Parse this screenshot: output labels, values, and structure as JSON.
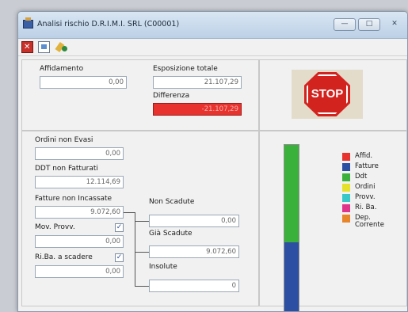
{
  "window": {
    "title": "Analisi rischio D.R.I.M.I. SRL (C00001)",
    "buttons": {
      "minimize": "—",
      "maximize": "□",
      "close": "✕"
    }
  },
  "toolbar": {
    "icons": [
      "close-red-icon",
      "document-icon",
      "tools-icon"
    ]
  },
  "top_left": {
    "affidamento_label": "Affidamento",
    "affidamento_value": "0,00",
    "esposizione_label": "Esposizione totale",
    "esposizione_value": "21.107,29",
    "differenza_label": "Differenza",
    "differenza_value": "-21.107,29"
  },
  "stop": {
    "text": "STOP"
  },
  "bottom_left": {
    "ordini_label": "Ordini non Evasi",
    "ordini_value": "0,00",
    "ddt_label": "DDT non Fatturati",
    "ddt_value": "12.114,69",
    "fatture_label": "Fatture non Incassate",
    "fatture_value": "9.072,60",
    "mov_label": "Mov. Provv.",
    "mov_checked": "✓",
    "mov_value": "0,00",
    "riba_label": "Ri.Ba. a scadere",
    "riba_checked": "✓",
    "riba_value": "0,00",
    "non_scadute_label": "Non Scadute",
    "non_scadute_value": "0,00",
    "gia_scadute_label": "Già Scadute",
    "gia_scadute_value": "9.072,60",
    "insolute_label": "Insolute",
    "insolute_value": "0"
  },
  "chart_data": {
    "type": "bar",
    "categories": [
      ""
    ],
    "series": [
      {
        "name": "Affid.",
        "color": "#e8322e",
        "values": [
          0
        ]
      },
      {
        "name": "Fatture",
        "color": "#2c4fa3",
        "values": [
          9072.6
        ]
      },
      {
        "name": "Ddt",
        "color": "#3ab13a",
        "values": [
          12114.69
        ]
      },
      {
        "name": "Ordini",
        "color": "#e5e02a",
        "values": [
          0
        ]
      },
      {
        "name": "Provv.",
        "color": "#38c8c8",
        "values": [
          0
        ]
      },
      {
        "name": "Ri. Ba.",
        "color": "#e0338a",
        "values": [
          0
        ]
      },
      {
        "name": "Dep. Corrente",
        "color": "#e8842a",
        "values": [
          0
        ]
      }
    ],
    "stacked": true
  }
}
